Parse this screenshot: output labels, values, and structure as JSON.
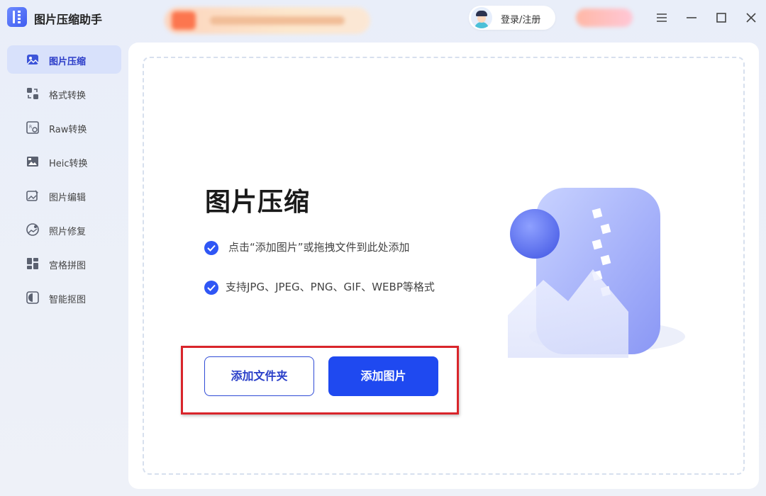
{
  "app": {
    "title": "图片压缩助手"
  },
  "header": {
    "login_label": "登录/注册"
  },
  "sidebar": {
    "items": [
      {
        "label": "图片压缩",
        "icon": "image-compress-icon",
        "active": true
      },
      {
        "label": "格式转换",
        "icon": "format-convert-icon",
        "active": false
      },
      {
        "label": "Raw转换",
        "icon": "raw-convert-icon",
        "active": false
      },
      {
        "label": "Heic转换",
        "icon": "heic-convert-icon",
        "active": false
      },
      {
        "label": "图片编辑",
        "icon": "image-edit-icon",
        "active": false
      },
      {
        "label": "照片修复",
        "icon": "photo-repair-icon",
        "active": false
      },
      {
        "label": "宫格拼图",
        "icon": "grid-collage-icon",
        "active": false
      },
      {
        "label": "智能抠图",
        "icon": "smart-cutout-icon",
        "active": false
      }
    ]
  },
  "main": {
    "title": "图片压缩",
    "tips": [
      "点击“添加图片”或拖拽文件到此处添加",
      "支持JPG、JPEG、PNG、GIF、WEBP等格式"
    ],
    "add_folder_label": "添加文件夹",
    "add_image_label": "添加图片"
  },
  "colors": {
    "accent": "#1f49f0",
    "highlight": "#d9252b",
    "sidebar_active_bg": "#d8e1fb"
  }
}
